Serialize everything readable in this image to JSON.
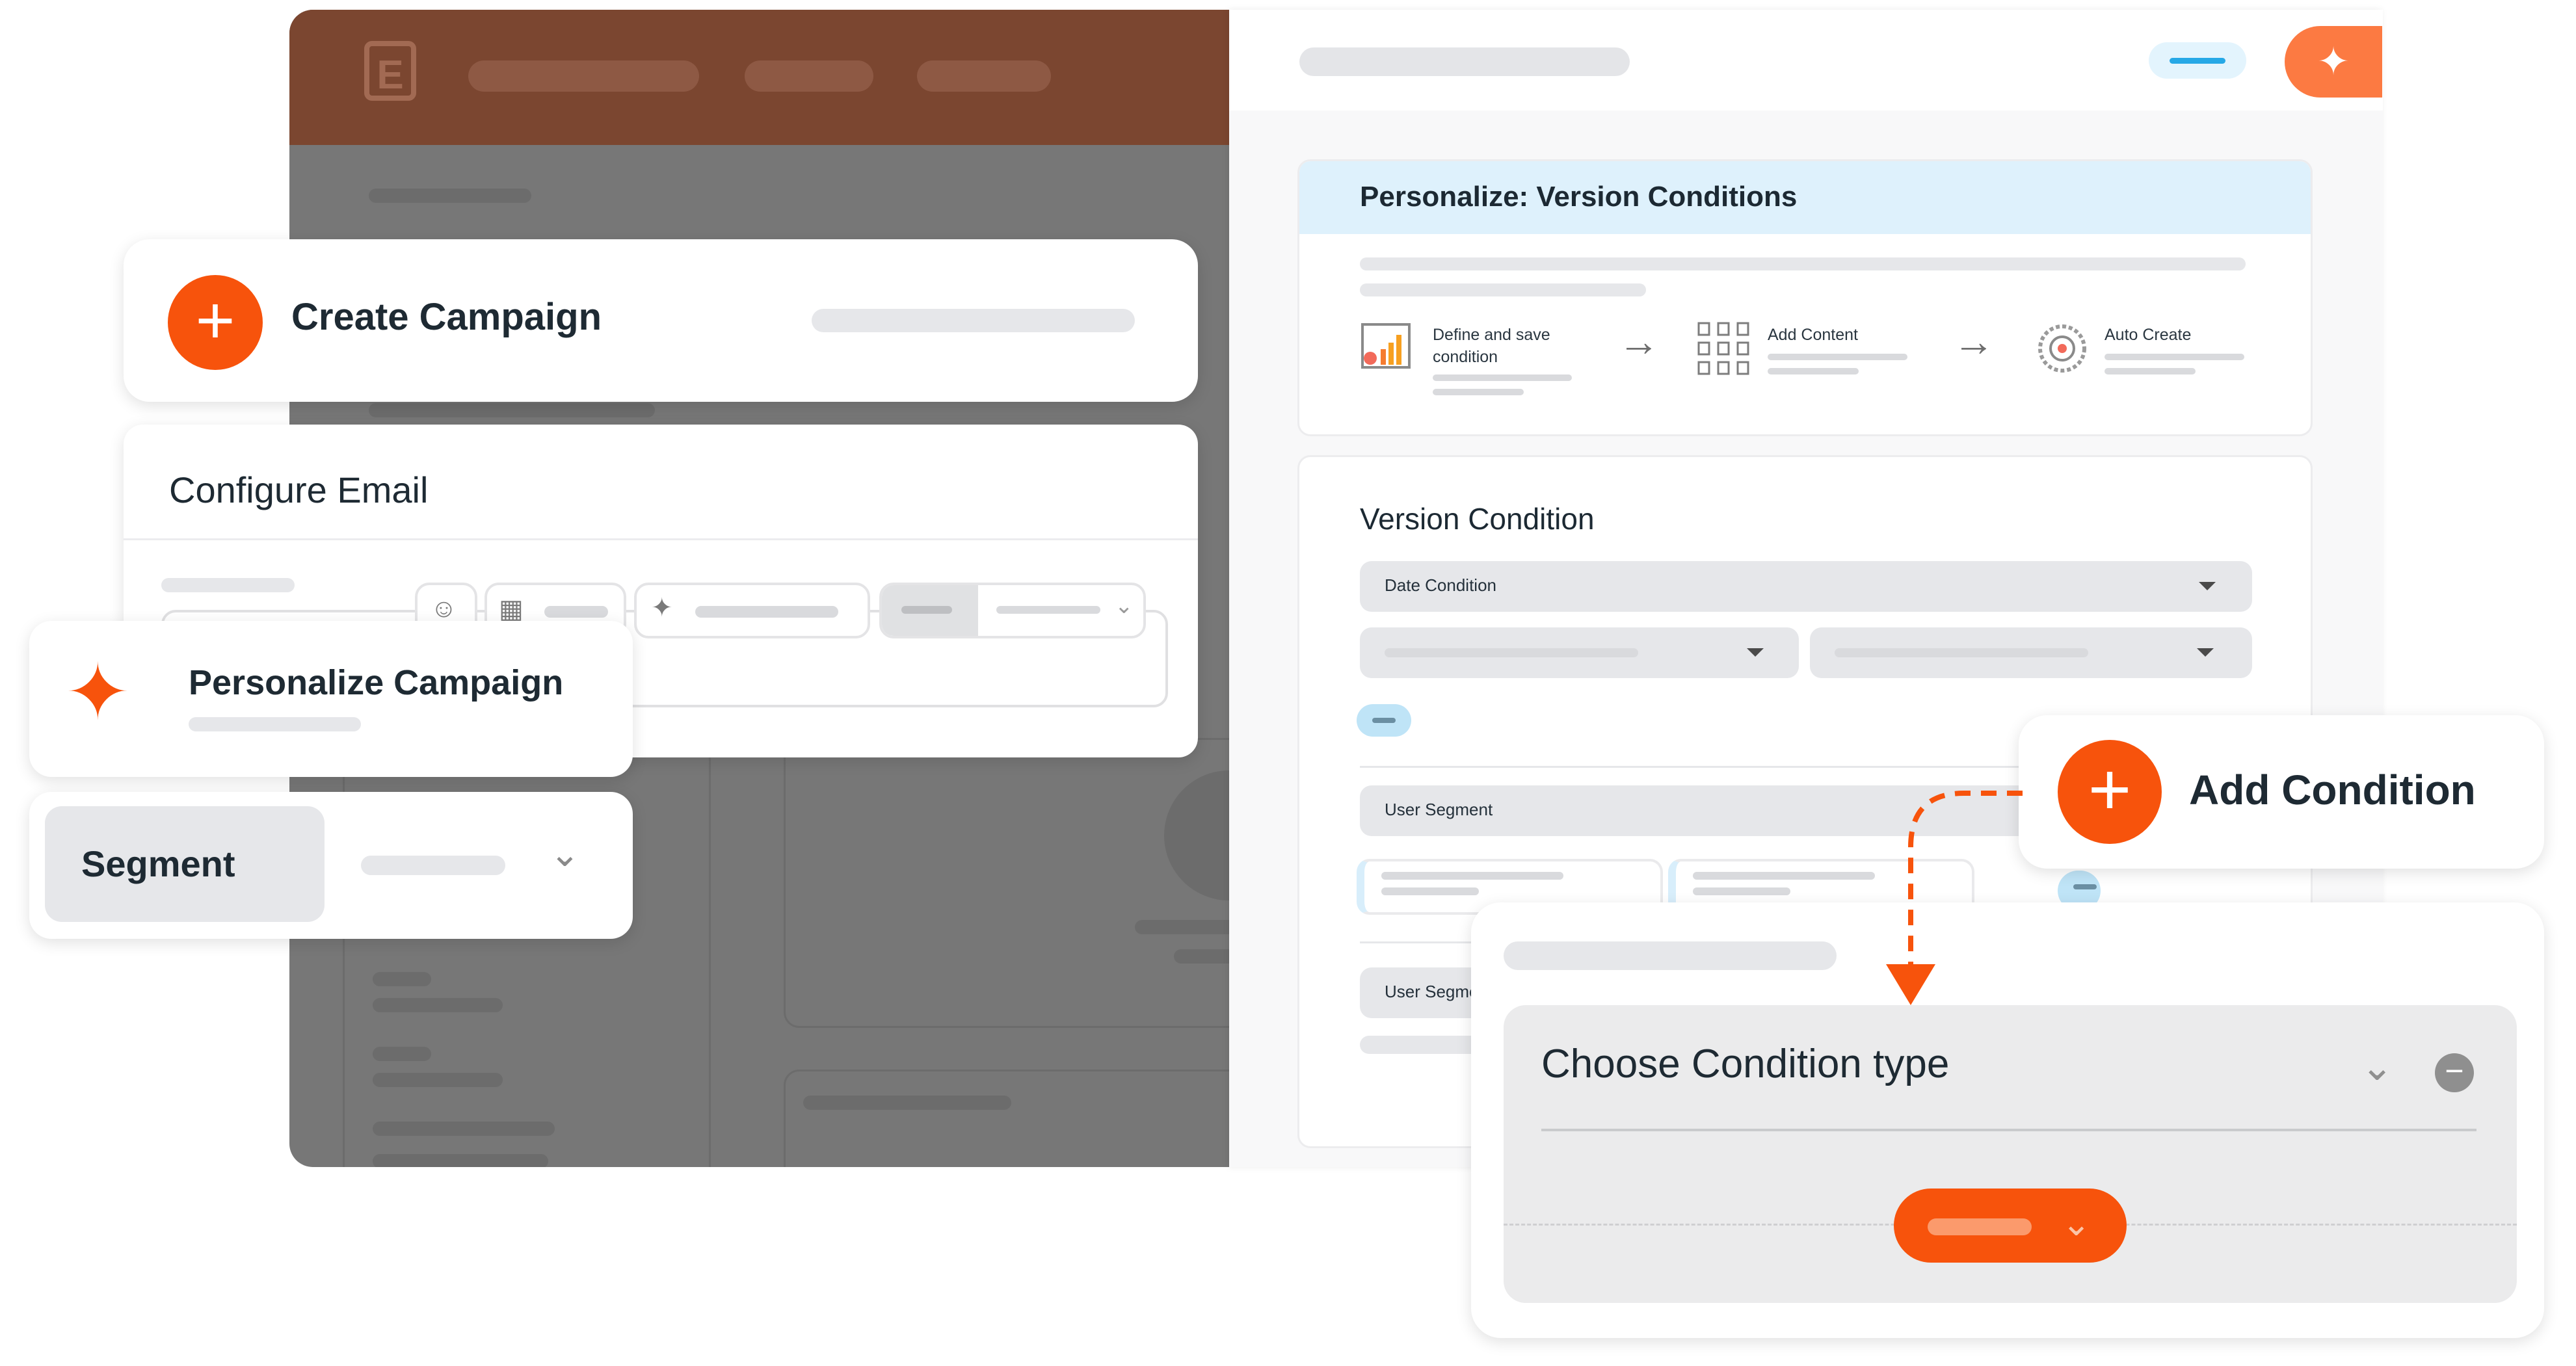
{
  "app_logo": "E",
  "right_panel": {
    "personalize_title": "Personalize: Version Conditions",
    "steps": [
      {
        "label": "Define and save condition",
        "icon": "chart-icon"
      },
      {
        "label": "Add Content",
        "icon": "grid-icon"
      },
      {
        "label": "Auto Create",
        "icon": "dial-icon"
      }
    ],
    "version_condition_title": "Version Condition",
    "date_condition_label": "Date Condition",
    "user_segment_label_1": "User Segment",
    "user_segment_label_2": "User Segme"
  },
  "cards": {
    "create_campaign": "Create Campaign",
    "configure_email": "Configure Email",
    "personalize_campaign": "Personalize Campaign",
    "segment": "Segment",
    "add_condition": "Add Condition",
    "choose_condition_type": "Choose Condition type"
  },
  "colors": {
    "accent_orange": "#f7530c",
    "header_brown": "#7b4630",
    "light_blue": "#def1fc"
  }
}
